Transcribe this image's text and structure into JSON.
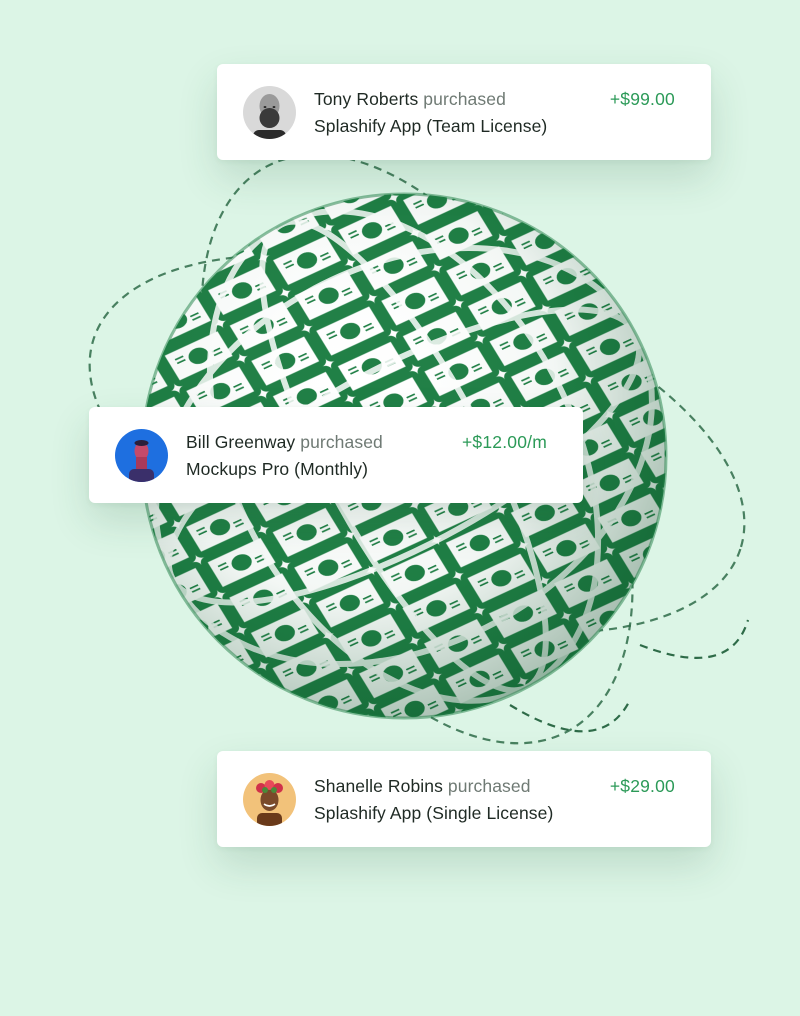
{
  "colors": {
    "background": "#dcf5e6",
    "accent_green": "#2c9a58",
    "globe_green": "#1f7f45",
    "orbit_stroke": "#2e6b48"
  },
  "globe": {
    "icon": "money-globe-icon"
  },
  "purchases": [
    {
      "name": "Tony Roberts",
      "verb": "purchased",
      "product": "Splashify App (Team License)",
      "amount": "+$99.00",
      "avatar": "avatar-bald-bearded-man"
    },
    {
      "name": "Bill Greenway",
      "verb": "purchased",
      "product": "Mockups Pro (Monthly)",
      "amount": "+$12.00/m",
      "avatar": "avatar-man-blue-background"
    },
    {
      "name": "Shanelle Robins",
      "verb": "purchased",
      "product": "Splashify App (Single License)",
      "amount": "+$29.00",
      "avatar": "avatar-woman-flower-crown"
    }
  ]
}
